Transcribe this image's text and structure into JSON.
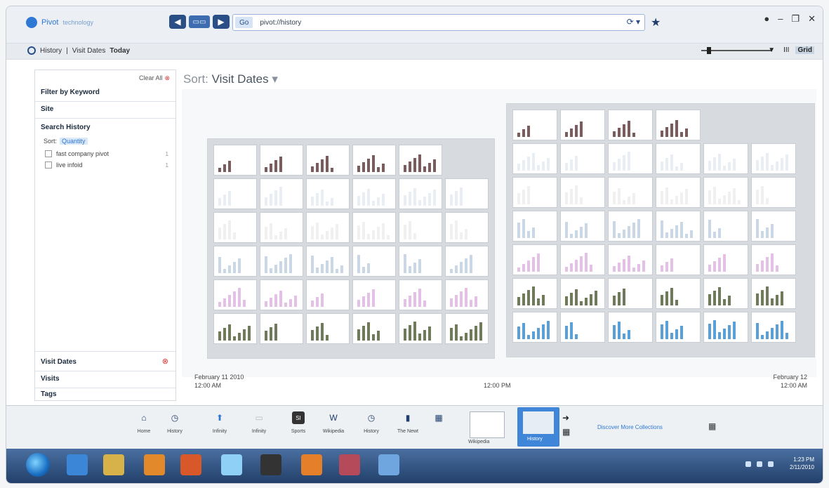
{
  "app": {
    "brand": "Pivot",
    "brand_sub": "technology"
  },
  "toolbar": {
    "go_label": "Go",
    "address": "pivot://history",
    "back": "◀",
    "forward": "▶",
    "middle": "▭▭"
  },
  "window_controls": [
    "●",
    "–",
    "❐",
    "✕"
  ],
  "breadcrumb": {
    "root": "History",
    "sep1": "|",
    "mid": "Visit Dates",
    "current": "Today"
  },
  "zoom_buttons": [
    {
      "label": "▼"
    },
    {
      "label": "III"
    },
    {
      "label": "Grid"
    }
  ],
  "sidebar": {
    "clear_all": "Clear All",
    "filter_by_keyword": "Filter by Keyword",
    "site": "Site",
    "search_history": "Search History",
    "sort_label": "Sort:",
    "sort_value": "Quantity",
    "filters": [
      {
        "label": "fast company pivot",
        "count": "1"
      },
      {
        "label": "live infoid",
        "count": "1"
      }
    ],
    "visit_dates": "Visit Dates",
    "visits": "Visits",
    "tags": "Tags"
  },
  "main": {
    "sort_prefix": "Sort:",
    "sort_value": "Visit Dates",
    "left_date": "February 11 2010",
    "left_time": "12:00 AM",
    "mid_time": "12:00 PM",
    "right_date": "February 12",
    "right_time": "12:00 AM"
  },
  "appbar": {
    "items": [
      {
        "label": "Home",
        "icon": "home-icon"
      },
      {
        "label": "History",
        "icon": "clock-icon"
      },
      {
        "label": "Infinity",
        "icon": "pin-icon"
      },
      {
        "label": "Infinity",
        "icon": "page-icon"
      },
      {
        "label": "Sports",
        "icon": "sports-icon"
      },
      {
        "label": "Wikipedia",
        "icon": "wikipedia-icon"
      },
      {
        "label": "History",
        "icon": "clock-icon"
      },
      {
        "label": "The Newt",
        "icon": "newt-icon"
      }
    ],
    "dock_label_1": "Wikipedia",
    "dock_label_2": "History",
    "discover": "Discover More Collections"
  },
  "windows_taskbar": {
    "time": "1:23 PM",
    "date": "2/11/2010"
  },
  "colors": {
    "accent": "#2f78d6",
    "taskbar": "#22406a",
    "selection": "#3f86d8"
  }
}
